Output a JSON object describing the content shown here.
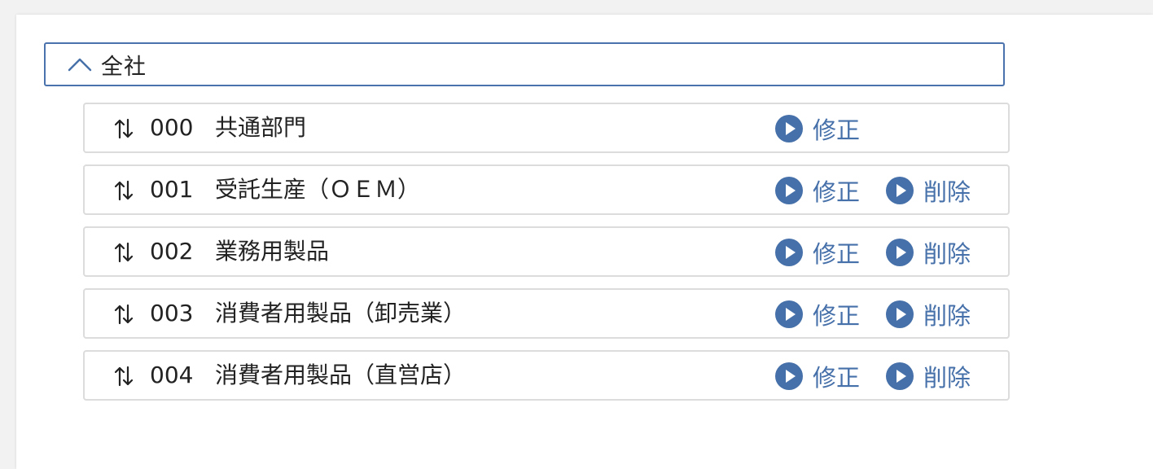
{
  "group": {
    "title": "全社",
    "chevron_icon": "chevron-up-icon"
  },
  "colors": {
    "accent": "#4670a9",
    "header_border": "#4a72ac",
    "row_border": "#dcdcdc"
  },
  "actions": {
    "edit_label": "修正",
    "delete_label": "削除"
  },
  "rows": [
    {
      "code": "000",
      "name": "共通部門",
      "has_delete": false
    },
    {
      "code": "001",
      "name": "受託生産（ＯＥＭ）",
      "has_delete": true
    },
    {
      "code": "002",
      "name": "業務用製品",
      "has_delete": true
    },
    {
      "code": "003",
      "name": "消費者用製品（卸売業）",
      "has_delete": true
    },
    {
      "code": "004",
      "name": "消費者用製品（直営店）",
      "has_delete": true
    }
  ]
}
